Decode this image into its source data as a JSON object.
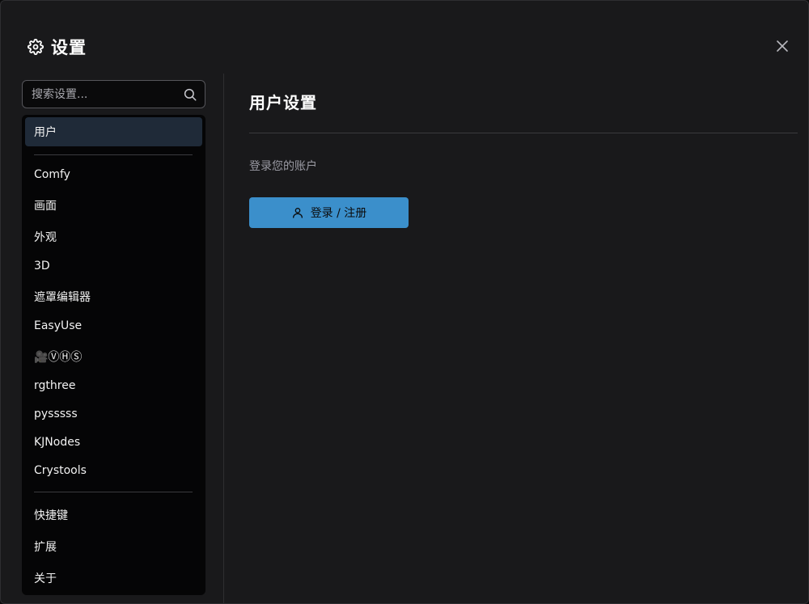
{
  "dialog": {
    "title": "设置",
    "close_icon": "close-icon",
    "title_icon": "gear-icon"
  },
  "sidebar": {
    "search_placeholder": "搜索设置...",
    "items": [
      {
        "label": "用户",
        "active": true
      },
      {
        "label": "Comfy"
      },
      {
        "label": "画面"
      },
      {
        "label": "外观"
      },
      {
        "label": "3D"
      },
      {
        "label": "遮罩编辑器"
      },
      {
        "label": "EasyUse"
      },
      {
        "label": "🎥ⓋⒽⓈ"
      },
      {
        "label": "rgthree"
      },
      {
        "label": "pysssss"
      },
      {
        "label": "KJNodes"
      },
      {
        "label": "Crystools"
      },
      {
        "label": "快捷键"
      },
      {
        "label": "扩展"
      },
      {
        "label": "关于"
      }
    ]
  },
  "content": {
    "title": "用户设置",
    "description": "登录您的账户",
    "login_button": "登录 / 注册"
  },
  "colors": {
    "accent": "#3b8fcb",
    "active_item": "#1f2a38",
    "panel_bg": "#19191b",
    "sidebar_bg": "#050506"
  }
}
